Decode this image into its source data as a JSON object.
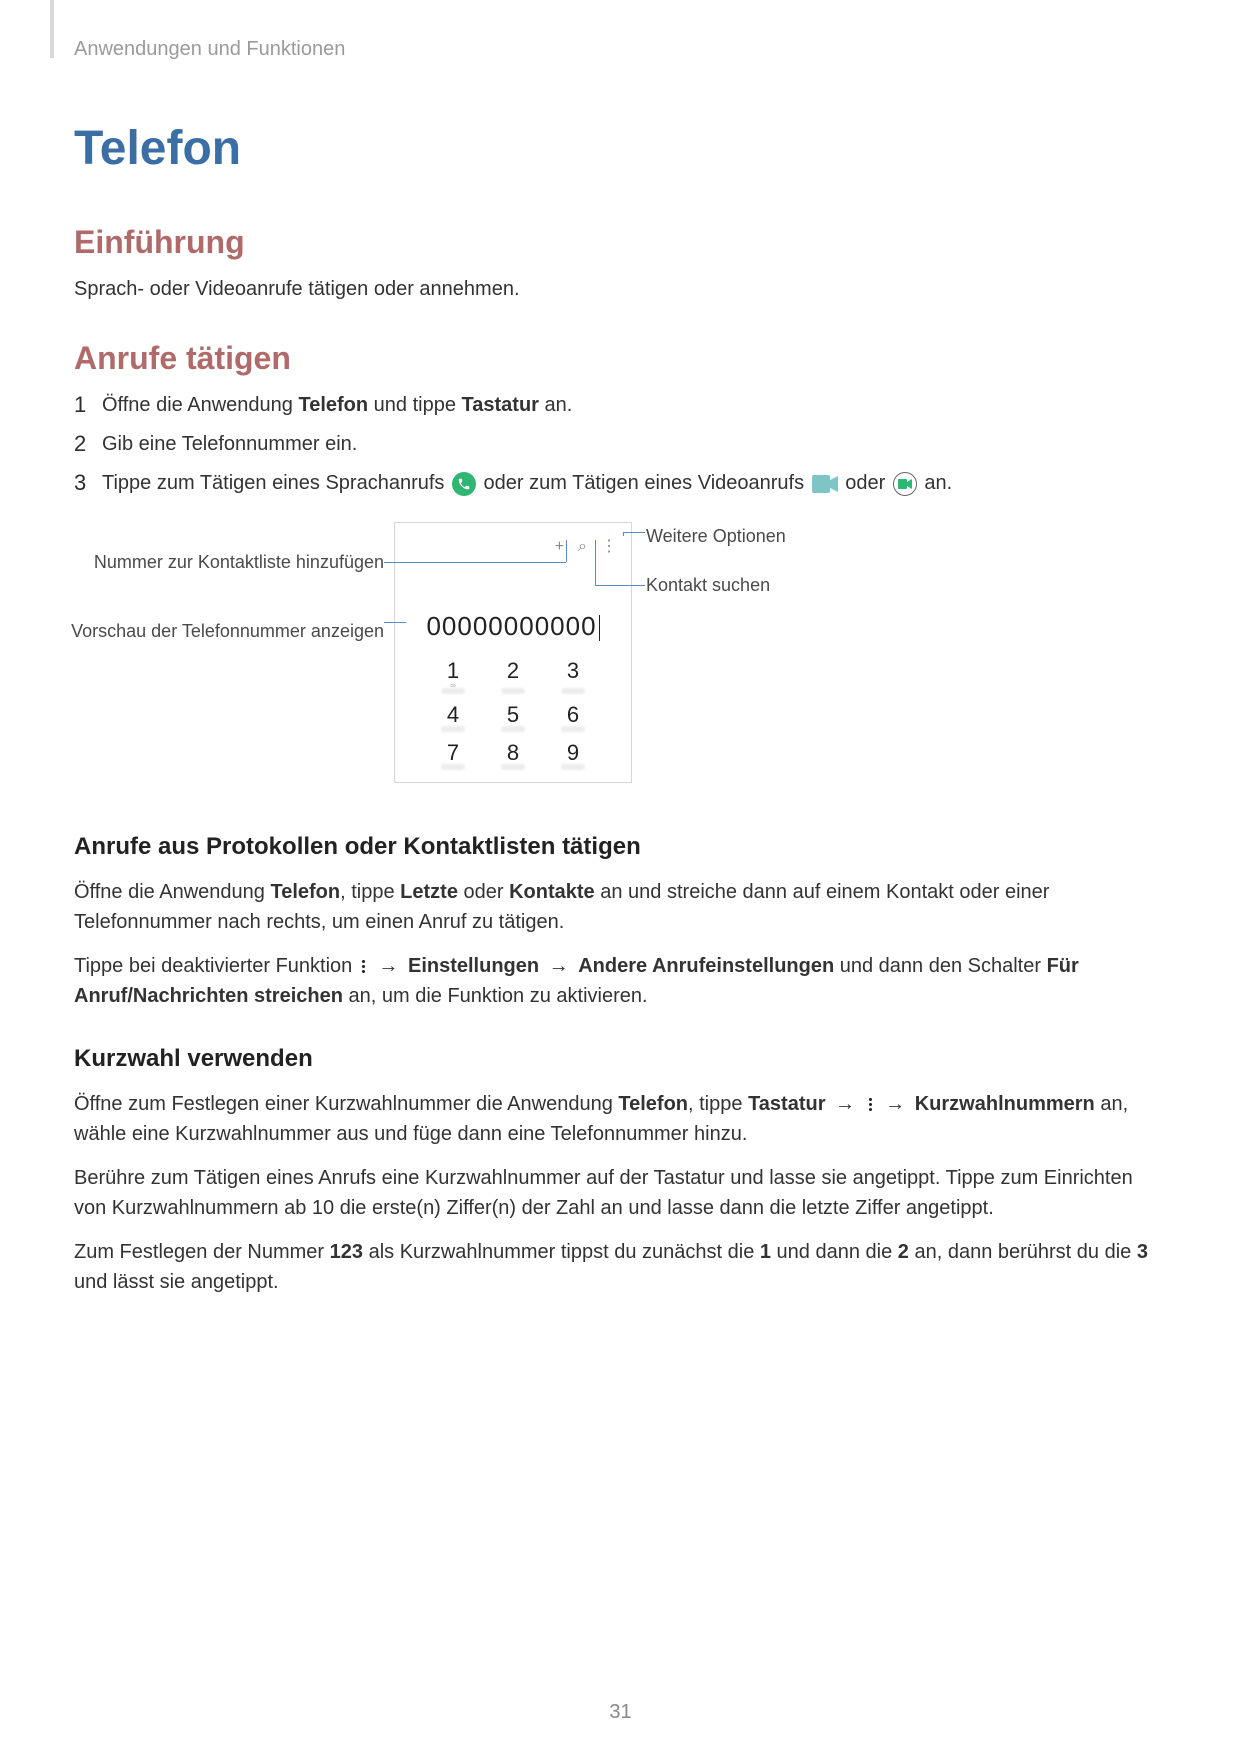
{
  "runningHead": "Anwendungen und Funktionen",
  "title": "Telefon",
  "section1": {
    "heading": "Einführung",
    "body": "Sprach- oder Videoanrufe tätigen oder annehmen."
  },
  "section2": {
    "heading": "Anrufe tätigen",
    "steps": {
      "n1": "1",
      "t1a": "Öffne die Anwendung ",
      "t1b": "Telefon",
      "t1c": " und tippe ",
      "t1d": "Tastatur",
      "t1e": " an.",
      "n2": "2",
      "t2": "Gib eine Telefonnummer ein.",
      "n3": "3",
      "t3a": "Tippe zum Tätigen eines Sprachanrufs ",
      "t3b": " oder zum Tätigen eines Videoanrufs ",
      "t3c": " oder ",
      "t3d": " an."
    }
  },
  "figure": {
    "callouts": {
      "addContact": "Nummer zur Kontaktliste hinzufügen",
      "previewNumber": "Vorschau der Telefonnummer anzeigen",
      "moreOptions": "Weitere Optionen",
      "searchContact": "Kontakt suchen"
    },
    "phone": {
      "topIcons": {
        "plus": "+",
        "search": "⌕",
        "more": "⋮"
      },
      "number": "00000000000",
      "keys": [
        "1",
        "2",
        "3",
        "4",
        "5",
        "6",
        "7",
        "8",
        "9"
      ]
    }
  },
  "section3": {
    "heading": "Anrufe aus Protokollen oder Kontaktlisten tätigen",
    "p1": {
      "a": "Öffne die Anwendung ",
      "b": "Telefon",
      "c": ", tippe ",
      "d": "Letzte",
      "e": " oder ",
      "f": "Kontakte",
      "g": " an und streiche dann auf einem Kontakt oder einer Telefonnummer nach rechts, um einen Anruf zu tätigen."
    },
    "p2": {
      "a": "Tippe bei deaktivierter Funktion ",
      "arrow1": "→",
      "b": "Einstellungen",
      "arrow2": "→",
      "c": "Andere Anrufeinstellungen",
      "d": " und dann den Schalter ",
      "e": "Für Anruf/Nachrichten streichen",
      "f": " an, um die Funktion zu aktivieren."
    }
  },
  "section4": {
    "heading": "Kurzwahl verwenden",
    "p1": {
      "a": "Öffne zum Festlegen einer Kurzwahlnummer die Anwendung ",
      "b": "Telefon",
      "c": ", tippe ",
      "d": "Tastatur",
      "arrow1": "→",
      "arrow2": "→",
      "e": "Kurzwahlnummern",
      "f": " an, wähle eine Kurzwahlnummer aus und füge dann eine Telefonnummer hinzu."
    },
    "p2": "Berühre zum Tätigen eines Anrufs eine Kurzwahlnummer auf der Tastatur und lasse sie angetippt. Tippe zum Einrichten von Kurzwahlnummern ab 10 die erste(n) Ziffer(n) der Zahl an und lasse dann die letzte Ziffer angetippt.",
    "p3": {
      "a": "Zum Festlegen der Nummer ",
      "b": "123",
      "c": " als Kurzwahlnummer tippst du zunächst die ",
      "d": "1",
      "e": " und dann die ",
      "f": "2",
      "g": " an, dann berührst du die ",
      "h": "3",
      "i": " und lässt sie angetippt."
    }
  },
  "pageNumber": "31"
}
